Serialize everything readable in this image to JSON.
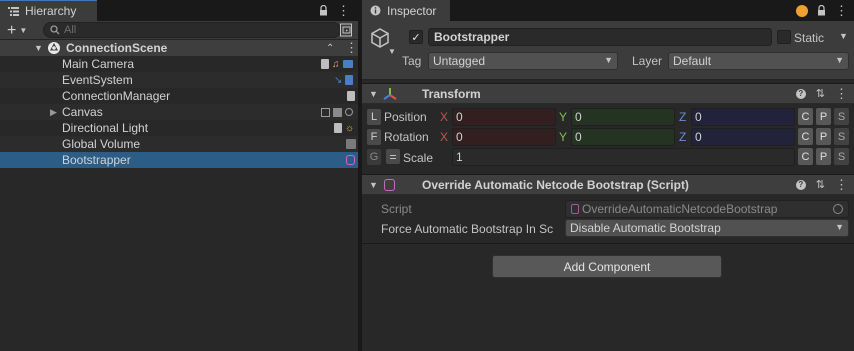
{
  "hierarchy": {
    "tab_label": "Hierarchy",
    "search_placeholder": "All",
    "scene_name": "ConnectionScene",
    "items": [
      {
        "label": "Main Camera"
      },
      {
        "label": "EventSystem"
      },
      {
        "label": "ConnectionManager"
      },
      {
        "label": "Canvas"
      },
      {
        "label": "Directional Light"
      },
      {
        "label": "Global Volume"
      },
      {
        "label": "Bootstrapper"
      }
    ]
  },
  "inspector": {
    "tab_label": "Inspector",
    "object_name": "Bootstrapper",
    "static_label": "Static",
    "tag_label": "Tag",
    "tag_value": "Untagged",
    "layer_label": "Layer",
    "layer_value": "Default",
    "transform": {
      "title": "Transform",
      "position_label": "Position",
      "rotation_label": "Rotation",
      "scale_label": "Scale",
      "position_btn": "L",
      "rotation_btn": "F",
      "scale_btn": "G",
      "axis_x": "X",
      "axis_y": "Y",
      "axis_z": "Z",
      "position": {
        "x": "0",
        "y": "0",
        "z": "0"
      },
      "rotation": {
        "x": "0",
        "y": "0",
        "z": "0"
      },
      "scale": "1",
      "c": "C",
      "p": "P",
      "s": "S"
    },
    "script_component": {
      "title": "Override Automatic Netcode Bootstrap (Script)",
      "script_label": "Script",
      "script_value": "OverrideAutomaticNetcodeBootstrap",
      "force_label": "Force Automatic Bootstrap In Sc",
      "force_value": "Disable Automatic Bootstrap"
    },
    "add_component_label": "Add Component"
  },
  "colors": {
    "selection": "#2c5d87",
    "accent_orange": "#f0a030"
  }
}
